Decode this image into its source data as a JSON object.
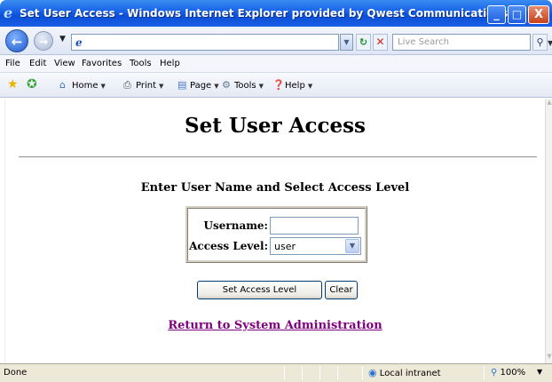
{
  "window": {
    "title": "Set User Access - Windows Internet Explorer provided by Qwest Communications",
    "minimize": "_",
    "maximize": "□",
    "close": "X"
  },
  "address_bar": {
    "url": "",
    "search_placeholder": "Live Search"
  },
  "menu": [
    "File",
    "Edit",
    "View",
    "Favorites",
    "Tools",
    "Help"
  ],
  "command_bar": {
    "home": "Home",
    "print": "Print",
    "page": "Page",
    "tools": "Tools",
    "help": "Help"
  },
  "page": {
    "title": "Set User Access",
    "subtitle": "Enter User Name and Select Access Level",
    "username_label": "Username:",
    "username_value": "",
    "access_label": "Access Level:",
    "access_value": "user",
    "set_button": "Set Access Level",
    "clear_button": "Clear",
    "return_link": "Return to System Administration"
  },
  "status": {
    "text": "Done",
    "zone": "Local intranet",
    "zoom": "100%"
  },
  "colors": {
    "title_bar": "#1660e8",
    "visited_link": "#800080",
    "status_bar": "#ece9d8"
  },
  "icons": [
    "ie-logo-icon",
    "back-icon",
    "forward-icon",
    "page-icon",
    "refresh-icon",
    "stop-icon",
    "search-icon",
    "favorites-star-icon",
    "add-favorites-icon",
    "home-icon",
    "print-icon",
    "page-menu-icon",
    "tools-icon",
    "help-icon",
    "globe-icon",
    "zoom-icon"
  ]
}
